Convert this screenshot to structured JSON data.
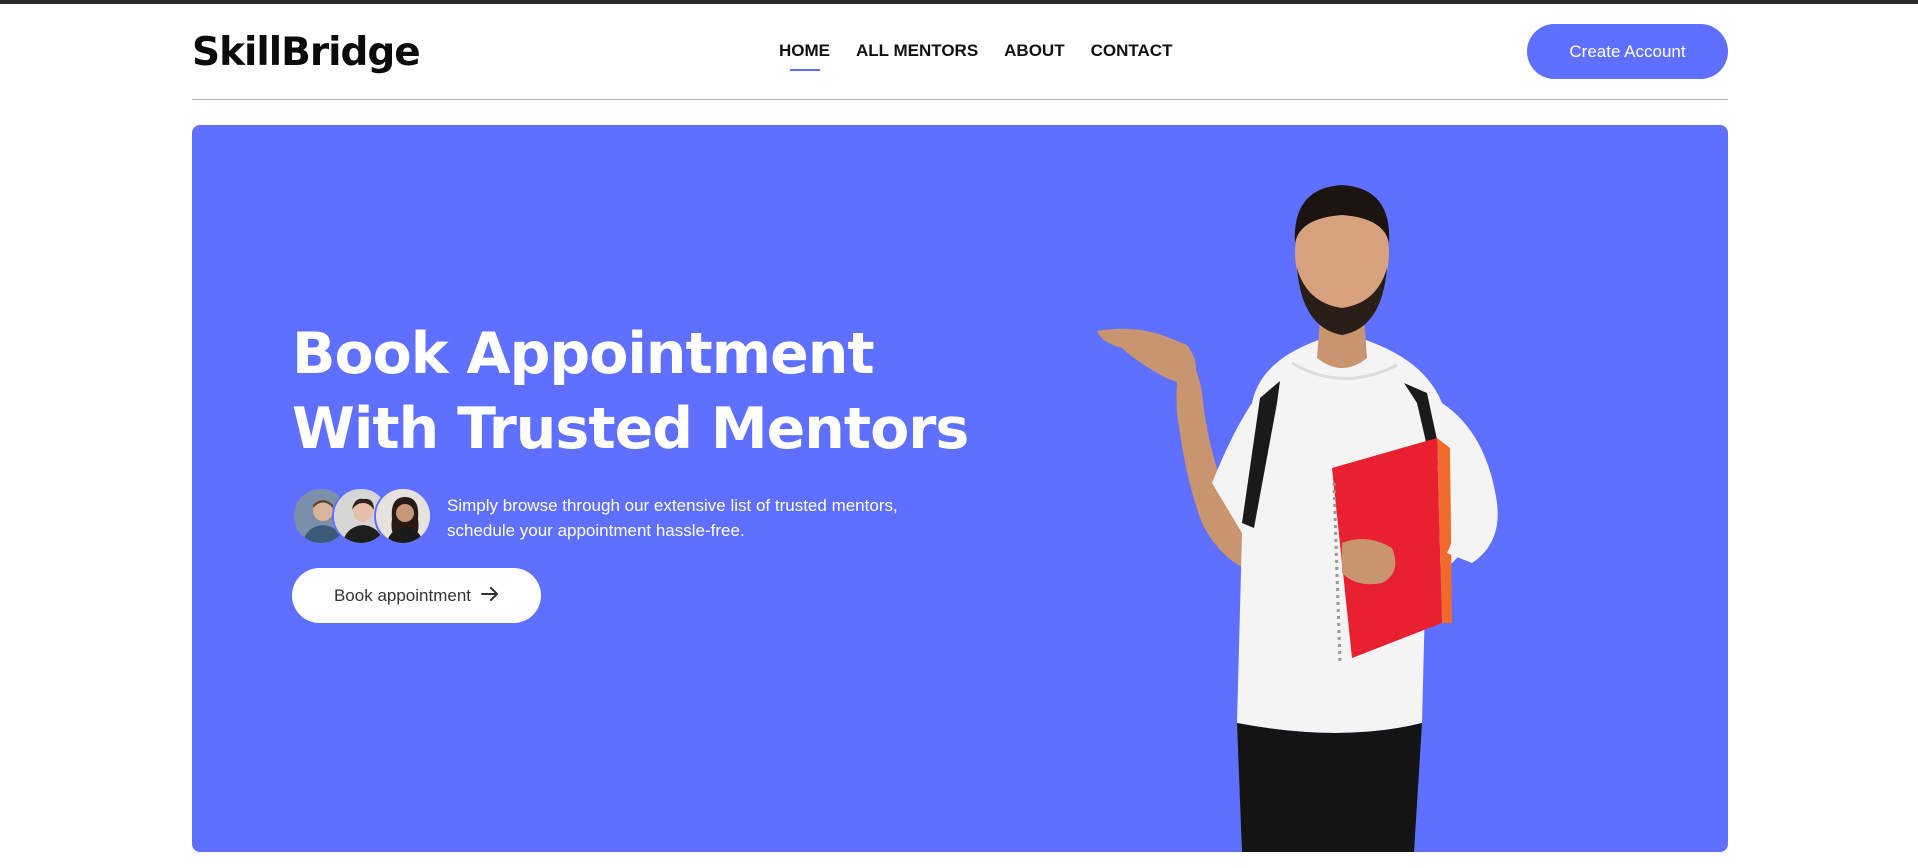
{
  "header": {
    "logo": "SkillBridge",
    "nav": [
      {
        "label": "HOME",
        "active": true
      },
      {
        "label": "ALL MENTORS",
        "active": false
      },
      {
        "label": "ABOUT",
        "active": false
      },
      {
        "label": "CONTACT",
        "active": false
      }
    ],
    "create_account_label": "Create Account"
  },
  "hero": {
    "title_line1": "Book Appointment",
    "title_line2": "With Trusted Mentors",
    "description_line1": "Simply browse through our extensive list of trusted mentors,",
    "description_line2": "schedule your appointment hassle-free.",
    "cta_label": "Book appointment",
    "cta_icon": "arrow-right-icon"
  },
  "colors": {
    "accent": "#5f6fff",
    "text_dark": "#111111",
    "white": "#ffffff"
  }
}
